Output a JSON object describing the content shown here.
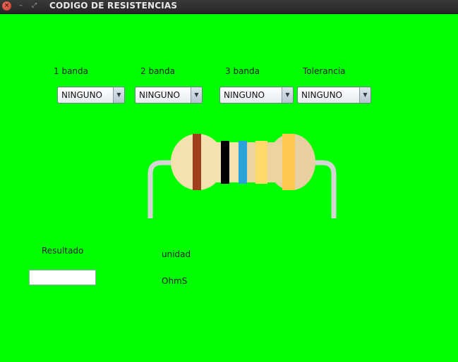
{
  "window": {
    "title": "CODIGO DE RESISTENCIAS",
    "buttons": {
      "close": "×",
      "minimize": "–",
      "maximize": "⤢"
    }
  },
  "bands": [
    {
      "label": "1 banda",
      "value": "NINGUNO"
    },
    {
      "label": "2 banda",
      "value": "NINGUNO"
    },
    {
      "label": "3 banda",
      "value": "NINGUNO"
    },
    {
      "label": "Tolerancia",
      "value": "NINGUNO"
    }
  ],
  "result": {
    "label": "Resultado",
    "value": ""
  },
  "unit": {
    "label": "unidad",
    "value": "OhmS"
  },
  "resistor": {
    "body_color": "#f5e1ad",
    "lead_color": "#d4d4d4",
    "band_colors": [
      "#a13f1a",
      "#000000",
      "#29a3d9",
      "#ffd86a",
      "#ffc850"
    ]
  },
  "colors": {
    "background": "#00ff00"
  }
}
